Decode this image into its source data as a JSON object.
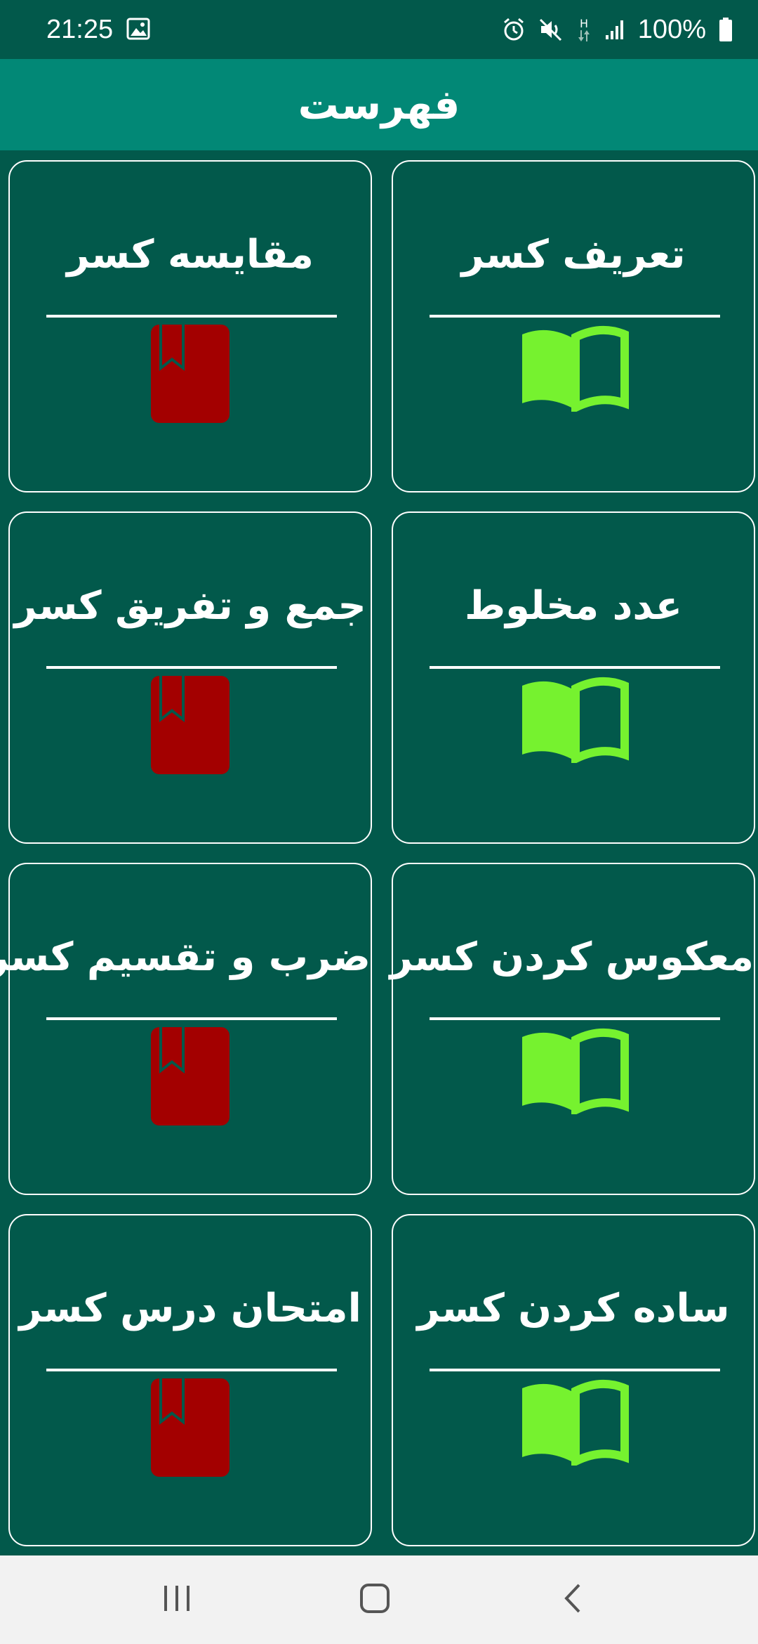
{
  "status_bar": {
    "time": "21:25",
    "battery": "100%",
    "icons": [
      "gallery-icon",
      "alarm-icon",
      "mute-icon",
      "network-h-icon",
      "signal-icon",
      "battery-icon"
    ]
  },
  "app_bar": {
    "title": "فهرست"
  },
  "cards": [
    {
      "title": "تعريف کسر",
      "icon": "open-book-icon"
    },
    {
      "title": "مقايسه کسر",
      "icon": "bookmarked-book-icon"
    },
    {
      "title": "عدد مخلوط",
      "icon": "open-book-icon"
    },
    {
      "title": "جمع و تفريق کسر",
      "icon": "bookmarked-book-icon"
    },
    {
      "title": "معکوس کردن کسر",
      "icon": "open-book-icon"
    },
    {
      "title": "ضرب و تقسيم کسر",
      "icon": "bookmarked-book-icon"
    },
    {
      "title": "ساده کردن کسر",
      "icon": "open-book-icon"
    },
    {
      "title": "امتحان درس کسر",
      "icon": "bookmarked-book-icon"
    }
  ],
  "nav_bar": {
    "icons": [
      "recent-apps-icon",
      "home-icon",
      "back-icon"
    ]
  },
  "colors": {
    "background": "#02594b",
    "app_bar": "#028876",
    "open_book": "#76f22f",
    "bookmarked_book": "#a30000",
    "nav_bar": "#f2f2f2"
  }
}
